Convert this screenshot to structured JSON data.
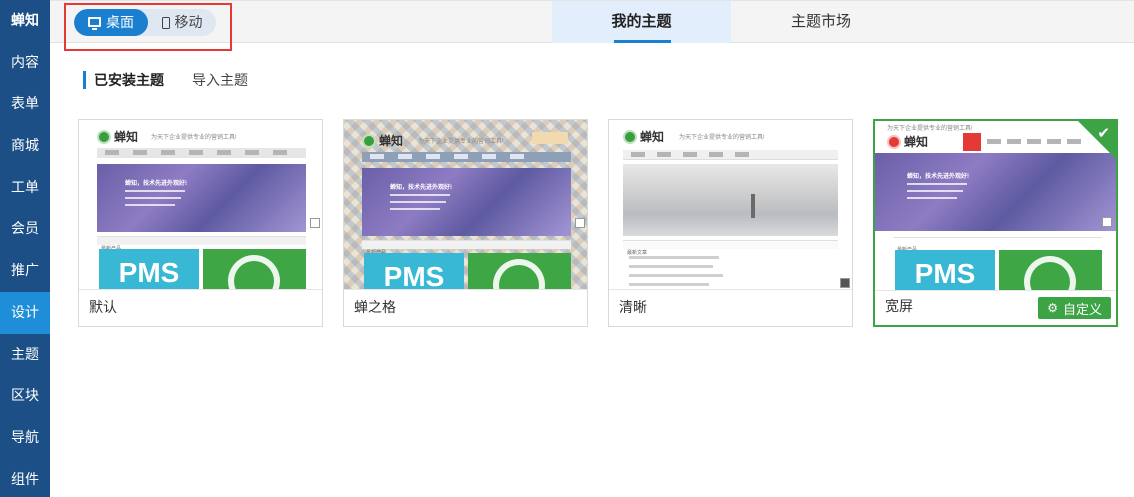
{
  "sidebar": {
    "items": [
      {
        "label": "蝉知"
      },
      {
        "label": "内容"
      },
      {
        "label": "表单"
      },
      {
        "label": "商城"
      },
      {
        "label": "工单"
      },
      {
        "label": "会员"
      },
      {
        "label": "推广"
      },
      {
        "label": "设计"
      },
      {
        "label": "主题"
      },
      {
        "label": "区块"
      },
      {
        "label": "导航"
      },
      {
        "label": "组件"
      }
    ],
    "active_index": 7
  },
  "topbar": {
    "device_switch": {
      "desktop_label": "桌面",
      "mobile_label": "移动",
      "selected": "desktop"
    },
    "tabs": [
      {
        "label": "我的主题"
      },
      {
        "label": "主题市场"
      }
    ],
    "active_tab": 0
  },
  "subtabs": {
    "installed_label": "已安装主题",
    "import_label": "导入主题"
  },
  "themes": [
    {
      "name": "默认",
      "logo_text": "蝉知",
      "tagline": "为天下企业提供专业的营销工具!",
      "banner_title": "蝉知，技术先进外观好!",
      "pms_text": "PMS",
      "section_label": "最新产品"
    },
    {
      "name": "蝉之格",
      "logo_text": "蝉知",
      "tagline": "为天下企业提供专业的营销工具!",
      "banner_title": "蝉知，技术先进外观好!",
      "pms_text": "PMS",
      "section_label": "最新产品"
    },
    {
      "name": "清晰",
      "logo_text": "蝉知",
      "tagline": "为天下企业提供专业的营销工具!",
      "section_label": "最新文章"
    },
    {
      "name": "宽屏",
      "logo_text": "蝉知",
      "tagline": "为天下企业提供专业的营销工具!",
      "banner_title": "蝉知，技术先进外观好!",
      "pms_text": "PMS",
      "section_label": "最新产品",
      "selected": true,
      "customize_label": "自定义"
    }
  ],
  "colors": {
    "sidebar": "#1b4f86",
    "sidebar_active": "#1f8ed8",
    "accent": "#1b7fd0",
    "selected": "#3da445",
    "highlight": "#e53935"
  },
  "icons": {
    "desktop": "monitor-icon",
    "mobile": "phone-icon",
    "check": "check-icon",
    "customize": "gear-icon"
  }
}
